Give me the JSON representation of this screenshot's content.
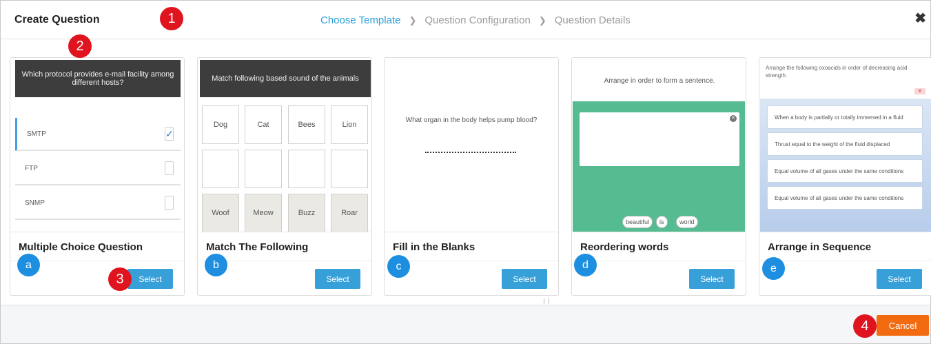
{
  "header": {
    "title": "Create Question",
    "steps": [
      "Choose Template",
      "Question Configuration",
      "Question Details"
    ],
    "close_icon": "close-icon"
  },
  "annotations": {
    "red": [
      "1",
      "2",
      "3",
      "4"
    ],
    "blue": [
      "a",
      "b",
      "c",
      "d",
      "e"
    ]
  },
  "cards": [
    {
      "title": "Multiple Choice Question",
      "select_label": "Select",
      "preview": {
        "question": "Which protocol provides e-mail facility among different hosts?",
        "options": [
          {
            "label": "SMTP",
            "checked": true
          },
          {
            "label": "FTP",
            "checked": false
          },
          {
            "label": "SNMP",
            "checked": false
          }
        ]
      }
    },
    {
      "title": "Match The Following",
      "select_label": "Select",
      "preview": {
        "question": "Match following based sound of the animals",
        "items": [
          "Dog",
          "Cat",
          "Bees",
          "Lion"
        ],
        "answers": [
          "Woof",
          "Meow",
          "Buzz",
          "Roar"
        ]
      }
    },
    {
      "title": "Fill in the Blanks",
      "select_label": "Select",
      "preview": {
        "question": "What organ in the body helps pump blood?"
      }
    },
    {
      "title": "Reordering words",
      "select_label": "Select",
      "preview": {
        "question": "Arrange in order to form a sentence.",
        "words": [
          "beautiful",
          "is",
          "world"
        ]
      }
    },
    {
      "title": "Arrange in Sequence",
      "select_label": "Select",
      "preview": {
        "question": "Arrange the following oxoacids in order of decreasing acid strength.",
        "items": [
          "When a body is partially or totally immersed in a fluid",
          "Thrust equal to the weight of the fluid displaced",
          "Equal volume of all gases under the same conditions",
          "Equal volume of all gases under the same conditions"
        ]
      }
    }
  ],
  "footer": {
    "cancel_label": "Cancel"
  },
  "colors": {
    "accent": "#2a9fd6",
    "select_button": "#37a0d9",
    "cancel_button": "#f26b11",
    "badge_red": "#e0141e",
    "badge_blue": "#1e8fe0"
  }
}
